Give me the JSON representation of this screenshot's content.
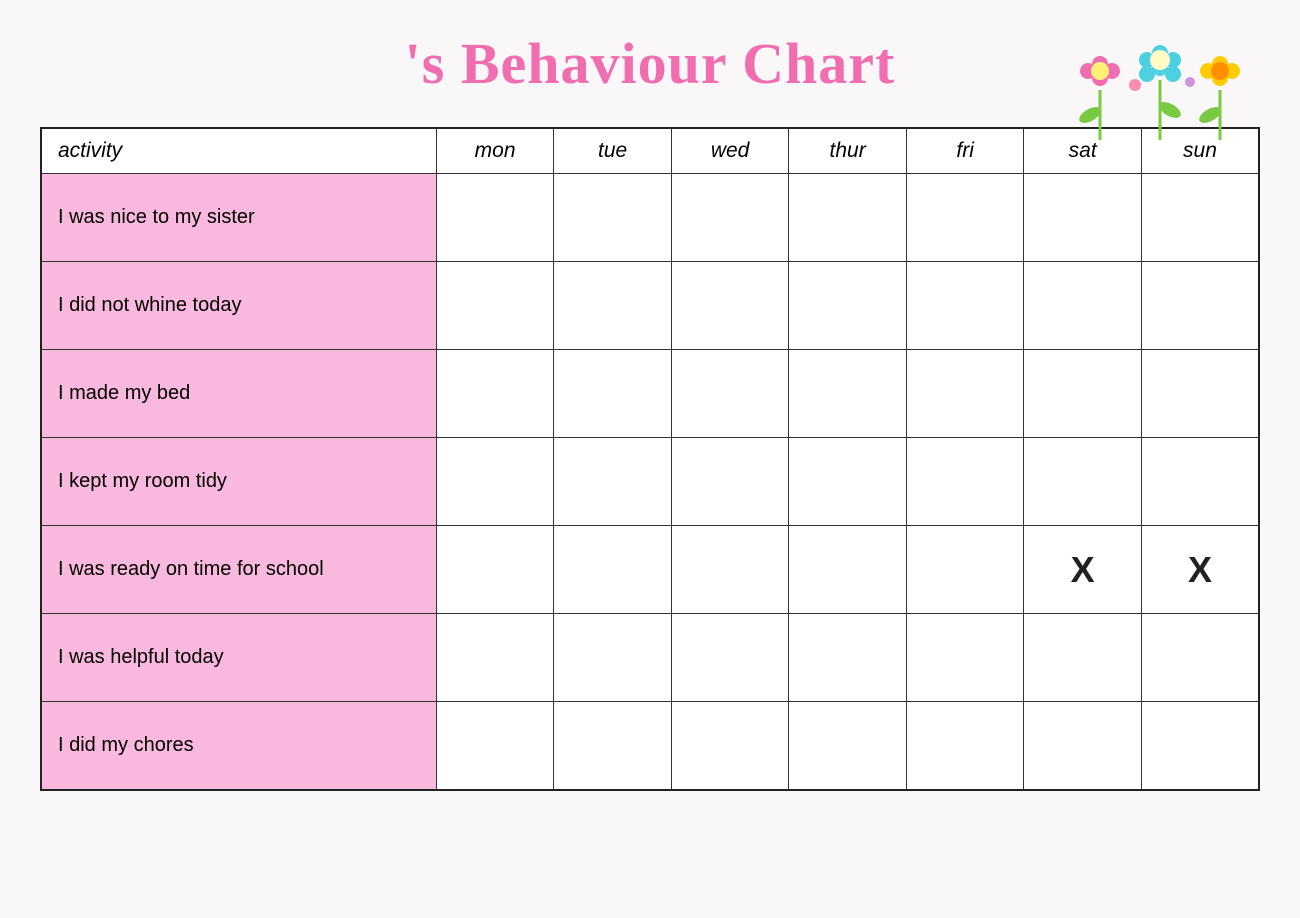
{
  "header": {
    "title": "'s Behaviour Chart"
  },
  "table": {
    "headers": [
      "activity",
      "mon",
      "tue",
      "wed",
      "thur",
      "fri",
      "sat",
      "sun"
    ],
    "rows": [
      {
        "activity": "I was nice to my sister",
        "days": [
          "",
          "",
          "",
          "",
          "",
          "",
          ""
        ]
      },
      {
        "activity": "I did not whine today",
        "days": [
          "",
          "",
          "",
          "",
          "",
          "",
          ""
        ]
      },
      {
        "activity": "I made my bed",
        "days": [
          "",
          "",
          "",
          "",
          "",
          "",
          ""
        ]
      },
      {
        "activity": "I kept my room tidy",
        "days": [
          "",
          "",
          "",
          "",
          "",
          "",
          ""
        ]
      },
      {
        "activity": "I was ready on time for school",
        "days": [
          "",
          "",
          "",
          "",
          "",
          "X",
          "X"
        ]
      },
      {
        "activity": "I was helpful today",
        "days": [
          "",
          "",
          "",
          "",
          "",
          "",
          ""
        ]
      },
      {
        "activity": "I did my chores",
        "days": [
          "",
          "",
          "",
          "",
          "",
          "",
          ""
        ]
      }
    ]
  }
}
